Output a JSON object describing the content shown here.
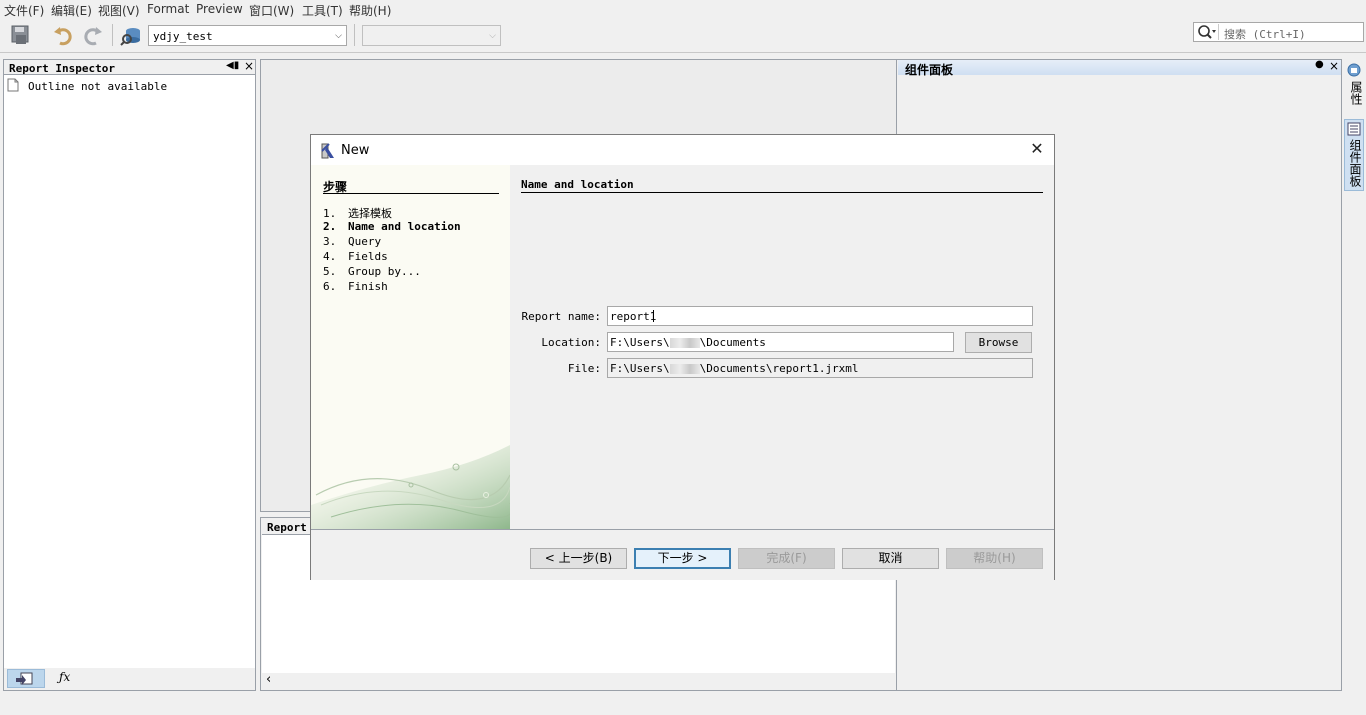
{
  "menu": [
    "文件(F)",
    "编辑(E)",
    "视图(V)",
    "Format",
    "Preview",
    "窗口(W)",
    "工具(T)",
    "帮助(H)"
  ],
  "toolbar": {
    "datasource": "ydjy_test",
    "second_combo": ""
  },
  "search": {
    "placeholder": "搜索 (Ctrl+I)"
  },
  "inspector": {
    "title": "Report Inspector",
    "outline_text": "Outline not available"
  },
  "palette": {
    "title": "组件面板"
  },
  "side_tabs": [
    "属性",
    "组件面板"
  ],
  "bottom_panel": {
    "title": "Report"
  },
  "dialog": {
    "title": "New",
    "steps_header": "步骤",
    "steps": [
      {
        "num": "1.",
        "label": "选择模板",
        "active": false
      },
      {
        "num": "2.",
        "label": "Name and location",
        "active": true
      },
      {
        "num": "3.",
        "label": "Query",
        "active": false
      },
      {
        "num": "4.",
        "label": "Fields",
        "active": false
      },
      {
        "num": "5.",
        "label": "Group by...",
        "active": false
      },
      {
        "num": "6.",
        "label": "Finish",
        "active": false
      }
    ],
    "section_title": "Name and location",
    "report_name_label": "Report name:",
    "report_name_value": "report1",
    "location_label": "Location:",
    "location_prefix": "F:\\Users\\",
    "location_suffix": "\\Documents",
    "browse_label": "Browse",
    "file_label": "File:",
    "file_prefix": "F:\\Users\\",
    "file_suffix": "\\Documents\\report1.jrxml",
    "buttons": {
      "back": "< 上一步(B)",
      "next": "下一步 >",
      "finish": "完成(F)",
      "cancel": "取消",
      "help": "帮助(H)"
    }
  }
}
